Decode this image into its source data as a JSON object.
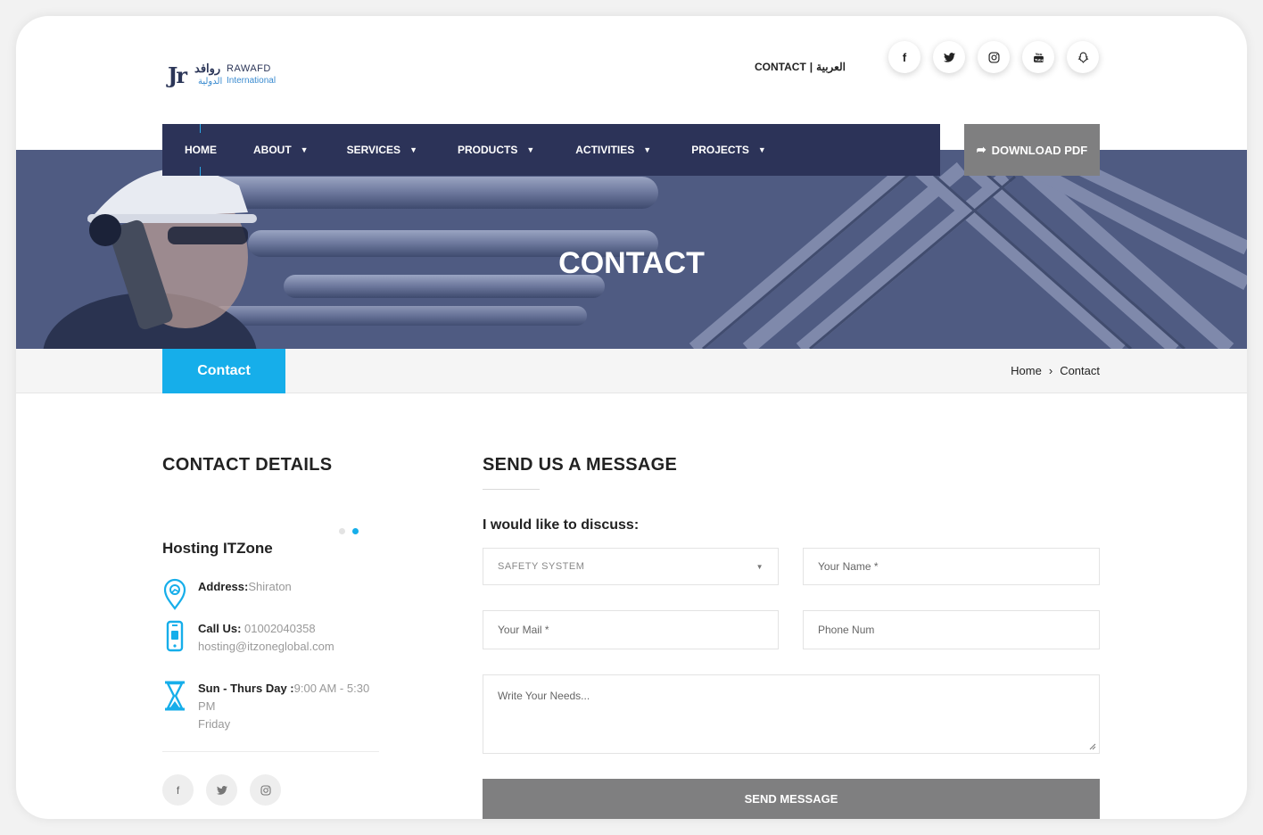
{
  "brand": {
    "mark": "Jr",
    "arabic_name": "روافد",
    "english_name": "RAWAFD",
    "arabic_sub": "الدولية",
    "english_sub": "International"
  },
  "top_links": {
    "contact": "CONTACT",
    "sep": "|",
    "arabic": "العربية"
  },
  "social_top": [
    {
      "icon": "facebook-icon",
      "glyph": "f"
    },
    {
      "icon": "twitter-icon",
      "glyph": "🐦"
    },
    {
      "icon": "instagram-icon",
      "glyph": "◎"
    },
    {
      "icon": "youtube-icon",
      "glyph": "▶"
    },
    {
      "icon": "snapchat-icon",
      "glyph": "☻"
    }
  ],
  "nav": {
    "home": "HOME",
    "about": "ABOUT",
    "services": "SERVICES",
    "products": "PRODUCTS",
    "activities": "ACTIVITIES",
    "projects": "PROJECTS",
    "caret": "▼",
    "download": "DOWNLOAD PDF",
    "download_icon": "➦"
  },
  "hero": {
    "title": "CONTACT"
  },
  "band": {
    "tab": "Contact",
    "crumb_home": "Home",
    "crumb_sep": "›",
    "crumb_current": "Contact"
  },
  "contact_details": {
    "heading": "CONTACT DETAILS",
    "company": "Hosting ITZone",
    "address_label": "Address:",
    "address_value": "Shiraton",
    "call_label": "Call Us:",
    "call_value": "01002040358",
    "email": "hosting@itzoneglobal.com",
    "hours_label": "Sun - Thurs Day :",
    "hours_value": "9:00 AM - 5:30 PM",
    "hours_extra": "Friday"
  },
  "social_bottom": [
    {
      "icon": "facebook-icon",
      "glyph": "f"
    },
    {
      "icon": "twitter-icon",
      "glyph": "🐦"
    },
    {
      "icon": "instagram-icon",
      "glyph": "◎"
    }
  ],
  "form": {
    "heading": "SEND US A MESSAGE",
    "discuss": "I would like to discuss:",
    "select_value": "SAFETY SYSTEM",
    "select_caret": "▼",
    "name_placeholder": "Your Name *",
    "mail_placeholder": "Your Mail *",
    "phone_placeholder": "Phone Num",
    "needs_placeholder": "Write Your Needs...",
    "submit": "SEND MESSAGE"
  },
  "colors": {
    "navy": "#2c3358",
    "accent": "#16aeea",
    "gray_button": "#7f7f80"
  }
}
